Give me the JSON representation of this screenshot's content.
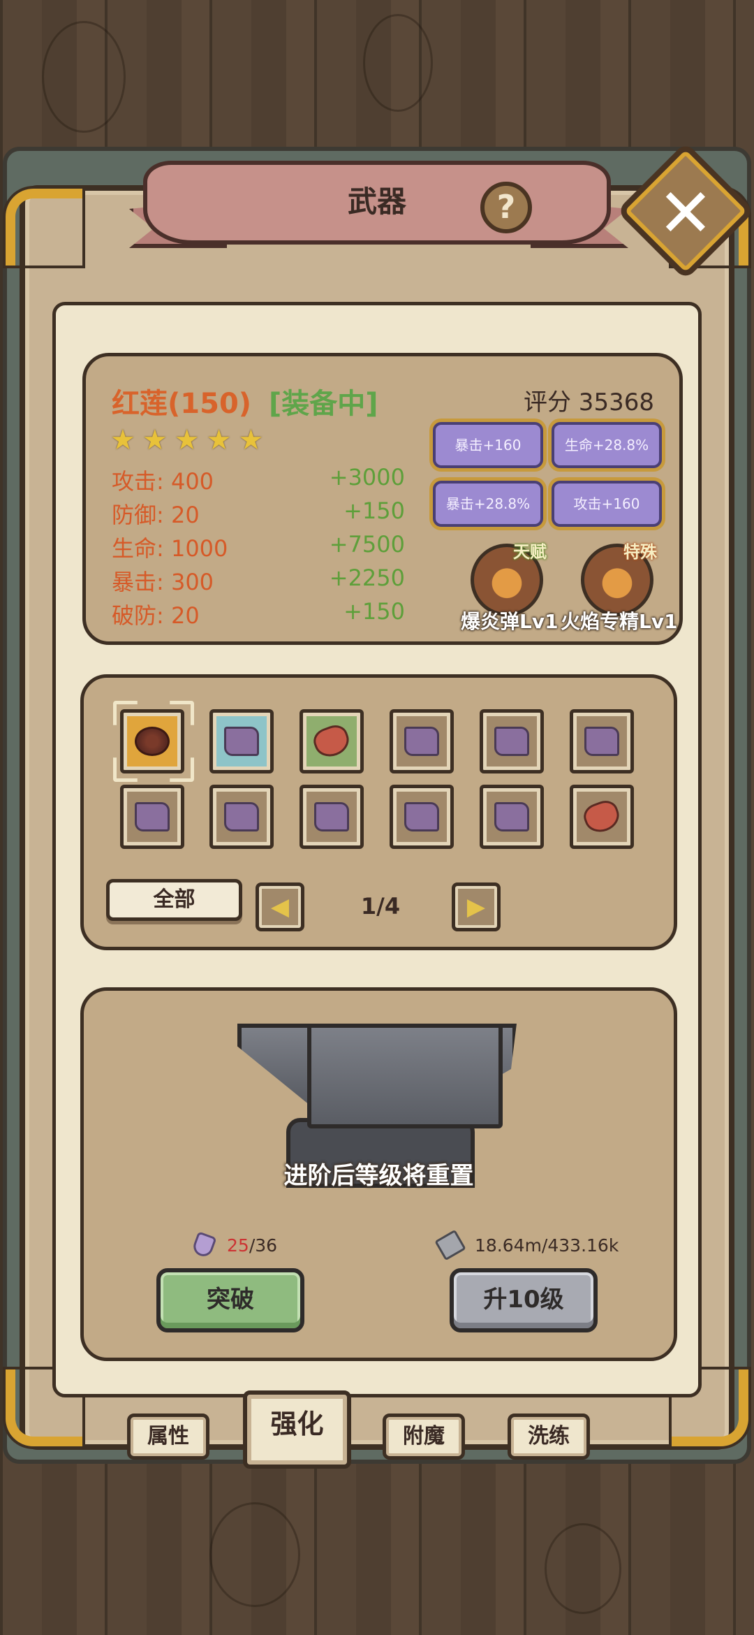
{
  "window": {
    "title": "武器"
  },
  "weapon": {
    "name": "红莲(150)",
    "status": "[装备中]",
    "score": "评分 35368",
    "stars": 5,
    "stats": [
      {
        "label": "攻击: 400",
        "bonus": "+3000"
      },
      {
        "label": "防御: 20",
        "bonus": "+150"
      },
      {
        "label": "生命: 1000",
        "bonus": "+7500"
      },
      {
        "label": "暴击: 300",
        "bonus": "+2250"
      },
      {
        "label": "破防: 20",
        "bonus": "+150"
      }
    ],
    "buffs": [
      "暴击+160",
      "生命+28.8%",
      "暴击+28.8%",
      "攻击+160"
    ],
    "skills": [
      {
        "tag": "天赋",
        "name": "爆炎弹Lv1"
      },
      {
        "tag": "特殊",
        "name": "火焰专精Lv1"
      }
    ]
  },
  "inventory": {
    "filter_label": "全部",
    "page": "1/4",
    "slots": [
      {
        "item": "grape-weapon-icon",
        "rarity": "gold",
        "selected": true
      },
      {
        "item": "book-icon",
        "rarity": "blue"
      },
      {
        "item": "gem-staff-icon",
        "rarity": "green"
      },
      {
        "item": "book-icon",
        "rarity": "plain"
      },
      {
        "item": "book-icon",
        "rarity": "plain"
      },
      {
        "item": "book-icon",
        "rarity": "plain"
      },
      {
        "item": "book-icon",
        "rarity": "plain"
      },
      {
        "item": "book-icon",
        "rarity": "plain"
      },
      {
        "item": "book-icon",
        "rarity": "plain"
      },
      {
        "item": "book-icon",
        "rarity": "plain"
      },
      {
        "item": "book-icon",
        "rarity": "plain"
      },
      {
        "item": "gem-staff-icon",
        "rarity": "plain"
      }
    ]
  },
  "upgrade": {
    "note": "进阶后等级将重置",
    "crystal_have": "25",
    "crystal_need": "/36",
    "scroll_cost": "18.64m/433.16k",
    "breakthrough_label": "突破",
    "level_up_label": "升10级"
  },
  "tabs": [
    {
      "label": "属性",
      "active": false
    },
    {
      "label": "强化",
      "active": true
    },
    {
      "label": "附魔",
      "active": false
    },
    {
      "label": "洗练",
      "active": false
    }
  ],
  "colors": {
    "stat_label": "#d65a28",
    "stat_bonus": "#5e9f3a",
    "equipped": "#5fa54a",
    "buff_bg": "#9c8ad1",
    "frame_gold": "#d9a432"
  }
}
